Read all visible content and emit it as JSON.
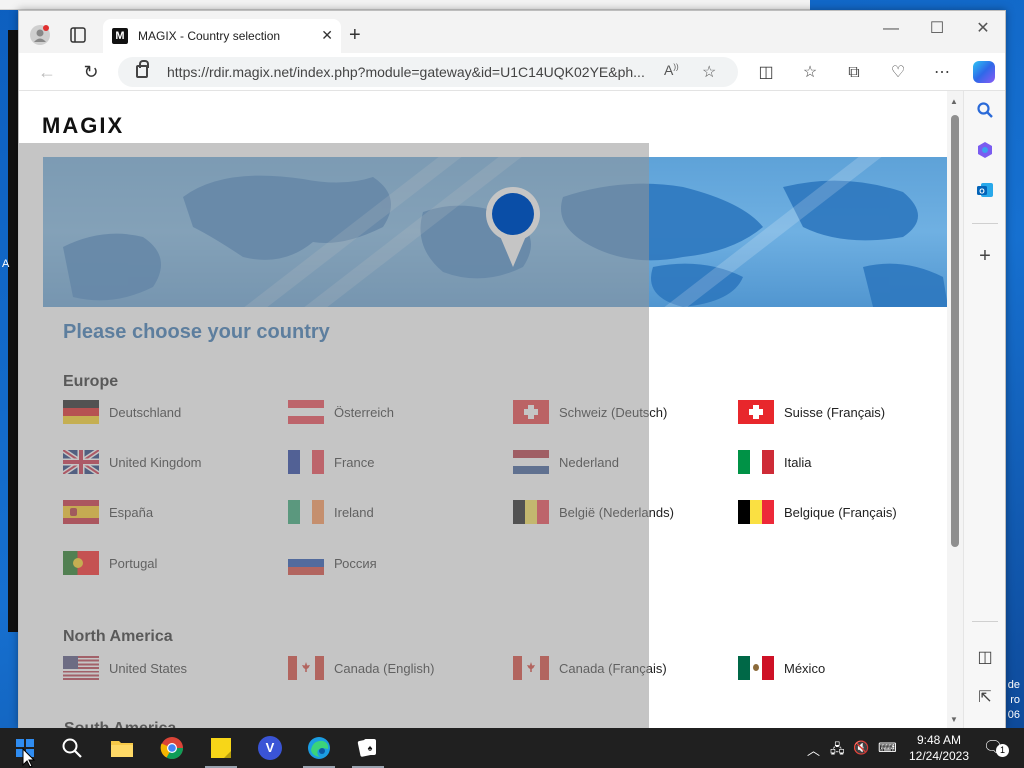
{
  "desktop": {
    "side_text": "de\nro\n06",
    "left_char": "A"
  },
  "browser": {
    "tab": {
      "favicon": "M",
      "title": "MAGIX - Country selection"
    },
    "url": "https://rdir.magix.net/index.php?module=gateway&id=U1C14UQK02YE&ph..."
  },
  "page": {
    "logo": "MAGIX",
    "heading": "Please choose your country",
    "regions": [
      {
        "title": "Europe",
        "countries": [
          "Deutschland",
          "Österreich",
          "Schweiz (Deutsch)",
          "Suisse (Français)",
          "United Kingdom",
          "France",
          "Nederland",
          "Italia",
          "España",
          "Ireland",
          "België (Nederlands)",
          "Belgique (Français)",
          "Portugal",
          "Россия"
        ]
      },
      {
        "title": "North America",
        "countries": [
          "United States",
          "Canada (English)",
          "Canada (Français)",
          "México"
        ]
      },
      {
        "title": "South America",
        "countries": []
      }
    ]
  },
  "taskbar": {
    "time": "9:48 AM",
    "date": "12/24/2023",
    "notification_count": "1",
    "v_app_letter": "V"
  }
}
